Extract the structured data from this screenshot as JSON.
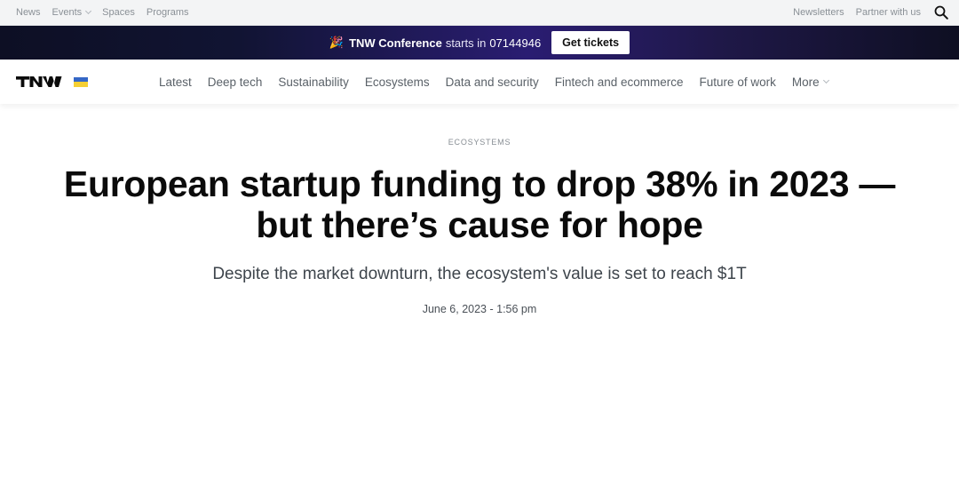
{
  "utility_nav": {
    "left": [
      {
        "label": "News"
      },
      {
        "label": "Events",
        "has_dropdown": true
      },
      {
        "label": "Spaces"
      },
      {
        "label": "Programs"
      }
    ],
    "right": [
      {
        "label": "Newsletters"
      },
      {
        "label": "Partner with us"
      }
    ],
    "search_icon": "search-icon"
  },
  "promo": {
    "emoji": "🎉",
    "brand": "TNW Conference",
    "text": "starts in",
    "countdown": "07144946",
    "cta": "Get tickets"
  },
  "main_nav": {
    "logo": "TNW",
    "flag": "ukraine-flag-icon",
    "links": [
      {
        "label": "Latest"
      },
      {
        "label": "Deep tech"
      },
      {
        "label": "Sustainability"
      },
      {
        "label": "Ecosystems"
      },
      {
        "label": "Data and security"
      },
      {
        "label": "Fintech and ecommerce"
      },
      {
        "label": "Future of work"
      },
      {
        "label": "More",
        "has_dropdown": true
      }
    ]
  },
  "article": {
    "kicker": "ECOSYSTEMS",
    "headline": "European startup funding to drop 38% in 2023 — but there’s cause for hope",
    "dek": "Despite the market downturn, the ecosystem's value is set to reach $1T",
    "date": "June 6, 2023 - 1:56 pm"
  },
  "colors": {
    "promo_gradient_mid": "#2a1d72",
    "utility_bg": "#f3f4f5",
    "flag_blue": "#3567c6",
    "flag_yellow": "#f5cf34"
  }
}
